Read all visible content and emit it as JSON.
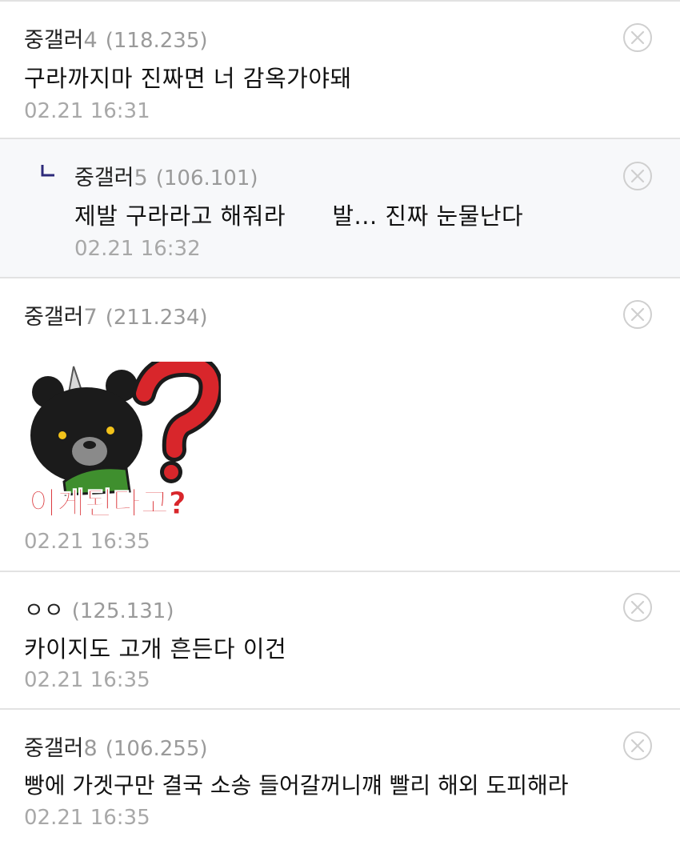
{
  "comments": [
    {
      "nick": "중갤러",
      "nick_no": "4",
      "ip": "(118.235)",
      "text": "구라까지마 진짜면 너 감옥가야돼",
      "date": "02.21 16:31"
    },
    {
      "nick": "중갤러",
      "nick_no": "5",
      "ip": "(106.101)",
      "text": "제발 구라라고 해줘라      발... 진짜 눈물난다",
      "date": "02.21 16:32"
    },
    {
      "nick": "중갤러",
      "nick_no": "7",
      "ip": "(211.234)",
      "sticker_text": "이게된다고?",
      "date": "02.21 16:35"
    },
    {
      "nick": "ㅇㅇ",
      "nick_no": "",
      "ip": "(125.131)",
      "text": "카이지도 고개 흔든다 이건",
      "date": "02.21 16:35"
    },
    {
      "nick": "중갤러",
      "nick_no": "8",
      "ip": "(106.255)",
      "text": "빵에 가겟구만 결국 소송 들어갈꺼니꺠 빨리 해외 도피해라",
      "date": "02.21 16:35"
    }
  ],
  "icons": {
    "delete": "close-circle-icon",
    "reply": "reply-arrow-icon"
  },
  "colors": {
    "reply_bg": "#f7f8fa",
    "divider": "#e2e2e2",
    "reply_mark": "#2d2a7a",
    "meta_gray": "#9a9a9a"
  }
}
